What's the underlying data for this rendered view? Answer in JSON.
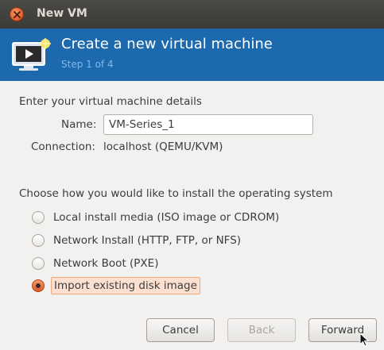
{
  "window": {
    "title": "New VM"
  },
  "banner": {
    "title": "Create a new virtual machine",
    "step": "Step 1 of 4",
    "icon": "monitor-play-icon"
  },
  "details": {
    "heading": "Enter your virtual machine details",
    "name_label": "Name:",
    "name_value": "VM-Series_1",
    "connection_label": "Connection:",
    "connection_value": "localhost (QEMU/KVM)"
  },
  "install": {
    "heading": "Choose how you would like to install the operating system",
    "options": [
      {
        "label": "Local install media (ISO image or CDROM)",
        "checked": false
      },
      {
        "label": "Network Install (HTTP, FTP, or NFS)",
        "checked": false
      },
      {
        "label": "Network Boot (PXE)",
        "checked": false
      },
      {
        "label": "Import existing disk image",
        "checked": true
      }
    ]
  },
  "buttons": {
    "cancel": "Cancel",
    "back": "Back",
    "forward": "Forward"
  },
  "colors": {
    "banner": "#1c6aad",
    "titlebar": "#3c3b37",
    "accent": "#dd5a27"
  }
}
